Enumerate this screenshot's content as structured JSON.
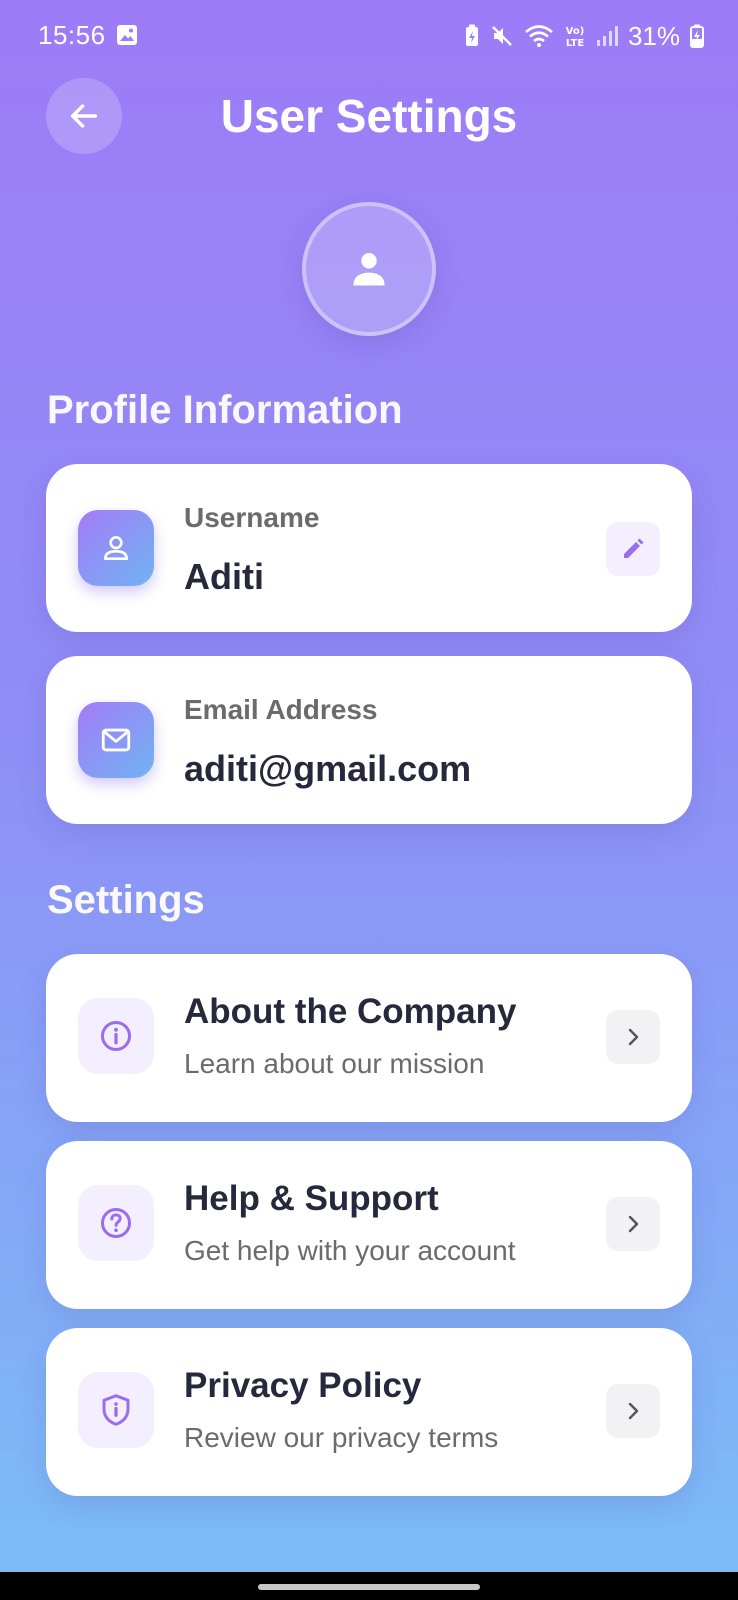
{
  "status_bar": {
    "time": "15:56",
    "battery": "31%",
    "icons": [
      "image-icon",
      "battery-saver-icon",
      "mute-icon",
      "wifi-icon",
      "volte-icon",
      "signal-icon",
      "charging-battery-icon"
    ]
  },
  "header": {
    "title": "User Settings",
    "back_icon": "arrow-left-icon"
  },
  "profile": {
    "avatar_icon": "person-icon",
    "section_title": "Profile Information",
    "username": {
      "label": "Username",
      "value": "Aditi",
      "icon": "user-icon",
      "action_icon": "pencil-icon"
    },
    "email": {
      "label": "Email Address",
      "value": "aditi@gmail.com",
      "icon": "mail-icon"
    }
  },
  "settings": {
    "section_title": "Settings",
    "items": [
      {
        "title": "About the Company",
        "subtitle": "Learn about our mission",
        "icon": "info-icon"
      },
      {
        "title": "Help & Support",
        "subtitle": "Get help with your account",
        "icon": "help-circle-icon"
      },
      {
        "title": "Privacy Policy",
        "subtitle": "Review our privacy terms",
        "icon": "shield-info-icon"
      }
    ]
  },
  "colors": {
    "gradient_top": "#9d7cf7",
    "gradient_bottom": "#7cbcf7",
    "accent_purple": "#9b6cf0",
    "text_dark": "#25293b",
    "text_muted": "#6b6b6b"
  }
}
